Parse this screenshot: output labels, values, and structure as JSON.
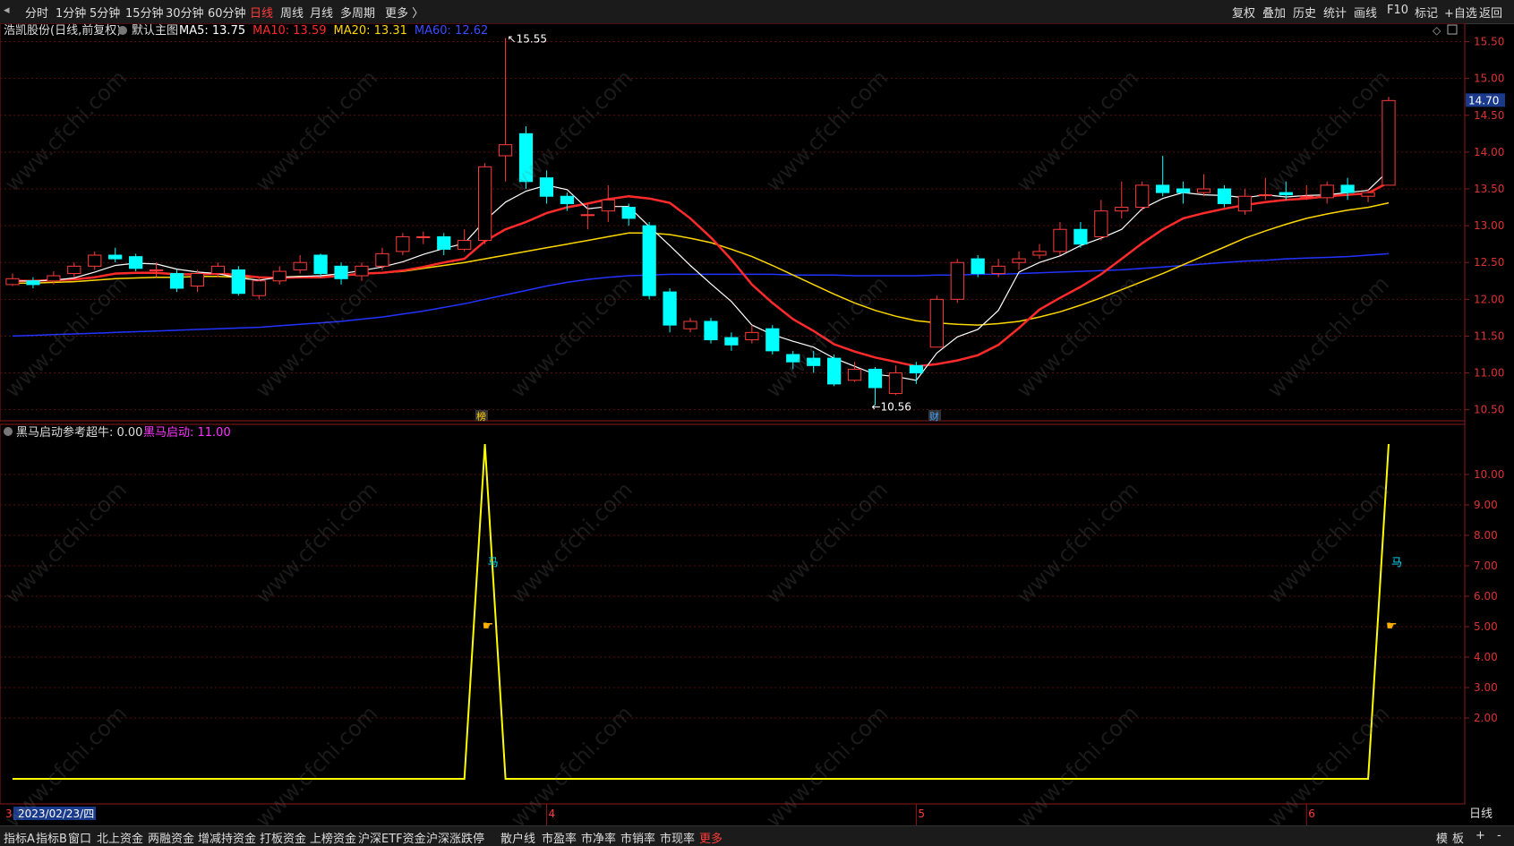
{
  "toolbar": {
    "periods": [
      "分时",
      "1分钟",
      "5分钟",
      "15分钟",
      "30分钟",
      "60分钟",
      "日线",
      "周线",
      "月线",
      "多周期",
      "更多 〉"
    ],
    "active_period": "日线",
    "right_buttons": [
      "复权",
      "叠加",
      "历史",
      "统计",
      "画线",
      "F10",
      "标记",
      "+自选",
      "返回"
    ]
  },
  "main_chart": {
    "stock_title": "浩凯股份(日线,前复权)",
    "template_label": "默认主图",
    "ma_legend": [
      {
        "label": "MA5: 13.75",
        "color": "#ffffff"
      },
      {
        "label": "MA10: 13.59",
        "color": "#ff2a2a"
      },
      {
        "label": "MA20: 13.31",
        "color": "#ffd700"
      },
      {
        "label": "MA60: 12.62",
        "color": "#3a4cff"
      }
    ],
    "high_label": "15.55",
    "low_label": "10.56",
    "current_price_tag": "14.70",
    "marker_rank": "榜",
    "marker_finance": "财",
    "price_axis": [
      "15.50",
      "15.00",
      "14.50",
      "14.00",
      "13.50",
      "13.00",
      "12.50",
      "12.00",
      "11.50",
      "11.00",
      "10.50"
    ],
    "colors": {
      "up": "#ff3b3b",
      "down": "#00ffff",
      "ma5": "#ffffff",
      "ma10": "#ff2a2a",
      "ma20": "#ffd700",
      "ma60": "#2233ff"
    }
  },
  "indicator": {
    "title": "黑马启动参考",
    "super_label": "超牛: 0.00",
    "dark_horse_label": "黑马启动: 11.00",
    "axis": [
      "10.00",
      "9.00",
      "8.00",
      "7.00",
      "6.00",
      "5.00",
      "4.00",
      "3.00",
      "2.00"
    ],
    "signal_char": "马",
    "line_color": "#ffff00"
  },
  "date_axis": {
    "cursor_date": "2023/02/23/四",
    "month_marks": [
      "4",
      "5",
      "6"
    ],
    "first_mark": "3",
    "period_label": "日线"
  },
  "bottom_tabs": [
    "指标A",
    "指标B",
    "窗口",
    "北上资金",
    "两融资金",
    "增减持资金",
    "打板资金",
    "上榜资金",
    "沪深ETF资金",
    "沪深涨跌停",
    "散户线",
    "市盈率",
    "市净率",
    "市销率",
    "市现率",
    "更多"
  ],
  "bottom_right": [
    "模",
    "板",
    "+",
    "-"
  ],
  "watermark": "www.cfchi.com",
  "chart_data": {
    "type": "candlestick",
    "candles": [
      [
        12.2,
        12.28,
        12.35,
        12.18
      ],
      [
        12.25,
        12.2,
        12.3,
        12.15
      ],
      [
        12.25,
        12.32,
        12.38,
        12.2
      ],
      [
        12.35,
        12.45,
        12.5,
        12.3
      ],
      [
        12.45,
        12.6,
        12.65,
        12.4
      ],
      [
        12.6,
        12.55,
        12.7,
        12.5
      ],
      [
        12.58,
        12.42,
        12.62,
        12.38
      ],
      [
        12.4,
        12.4,
        12.5,
        12.3
      ],
      [
        12.35,
        12.15,
        12.4,
        12.1
      ],
      [
        12.18,
        12.35,
        12.4,
        12.1
      ],
      [
        12.35,
        12.45,
        12.5,
        12.3
      ],
      [
        12.4,
        12.08,
        12.45,
        12.05
      ],
      [
        12.05,
        12.25,
        12.3,
        12.0
      ],
      [
        12.25,
        12.38,
        12.45,
        12.2
      ],
      [
        12.4,
        12.5,
        12.6,
        12.35
      ],
      [
        12.6,
        12.35,
        12.62,
        12.3
      ],
      [
        12.45,
        12.28,
        12.5,
        12.2
      ],
      [
        12.32,
        12.45,
        12.5,
        12.25
      ],
      [
        12.45,
        12.62,
        12.7,
        12.4
      ],
      [
        12.65,
        12.85,
        12.9,
        12.6
      ],
      [
        12.85,
        12.85,
        12.92,
        12.75
      ],
      [
        12.85,
        12.68,
        12.9,
        12.6
      ],
      [
        12.68,
        12.8,
        12.95,
        12.65
      ],
      [
        12.8,
        13.8,
        13.85,
        12.75
      ],
      [
        13.95,
        14.1,
        15.55,
        13.6
      ],
      [
        14.25,
        13.6,
        14.35,
        13.5
      ],
      [
        13.65,
        13.4,
        13.75,
        13.3
      ],
      [
        13.4,
        13.3,
        13.45,
        13.2
      ],
      [
        13.15,
        13.15,
        13.3,
        12.95
      ],
      [
        13.2,
        13.35,
        13.55,
        13.05
      ],
      [
        13.25,
        13.1,
        13.3,
        13.0
      ],
      [
        13.0,
        12.05,
        13.05,
        12.0
      ],
      [
        12.1,
        11.65,
        12.15,
        11.55
      ],
      [
        11.6,
        11.7,
        11.75,
        11.55
      ],
      [
        11.7,
        11.45,
        11.75,
        11.4
      ],
      [
        11.48,
        11.38,
        11.55,
        11.3
      ],
      [
        11.45,
        11.55,
        11.65,
        11.4
      ],
      [
        11.6,
        11.3,
        11.65,
        11.25
      ],
      [
        11.25,
        11.15,
        11.3,
        11.05
      ],
      [
        11.2,
        11.1,
        11.3,
        11.0
      ],
      [
        11.2,
        10.85,
        11.25,
        10.82
      ],
      [
        10.9,
        11.05,
        11.15,
        10.88
      ],
      [
        11.05,
        10.8,
        11.08,
        10.56
      ],
      [
        10.72,
        11.0,
        11.1,
        10.7
      ],
      [
        11.1,
        11.0,
        11.15,
        10.85
      ],
      [
        11.35,
        12.0,
        12.05,
        11.35
      ],
      [
        12.0,
        12.5,
        12.55,
        11.95
      ],
      [
        12.55,
        12.35,
        12.6,
        12.3
      ],
      [
        12.35,
        12.45,
        12.55,
        12.3
      ],
      [
        12.5,
        12.55,
        12.65,
        12.4
      ],
      [
        12.6,
        12.65,
        12.75,
        12.55
      ],
      [
        12.65,
        12.95,
        13.05,
        12.6
      ],
      [
        12.95,
        12.75,
        13.05,
        12.7
      ],
      [
        12.85,
        13.2,
        13.35,
        12.8
      ],
      [
        13.2,
        13.25,
        13.6,
        13.1
      ],
      [
        13.25,
        13.55,
        13.6,
        13.2
      ],
      [
        13.55,
        13.45,
        13.95,
        13.4
      ],
      [
        13.5,
        13.45,
        13.6,
        13.3
      ],
      [
        13.45,
        13.5,
        13.7,
        13.4
      ],
      [
        13.5,
        13.3,
        13.55,
        13.25
      ],
      [
        13.2,
        13.4,
        13.5,
        13.15
      ],
      [
        13.42,
        13.42,
        13.65,
        13.35
      ],
      [
        13.45,
        13.42,
        13.6,
        13.35
      ],
      [
        13.4,
        13.4,
        13.55,
        13.35
      ],
      [
        13.38,
        13.55,
        13.6,
        13.3
      ],
      [
        13.55,
        13.45,
        13.65,
        13.35
      ],
      [
        13.4,
        13.45,
        13.5,
        13.32
      ],
      [
        13.55,
        14.7,
        14.75,
        13.55
      ]
    ],
    "ma5": [
      12.25,
      12.25,
      12.26,
      12.29,
      12.37,
      12.46,
      12.49,
      12.48,
      12.41,
      12.37,
      12.35,
      12.29,
      12.26,
      12.3,
      12.31,
      12.32,
      12.35,
      12.39,
      12.44,
      12.51,
      12.61,
      12.69,
      12.76,
      13.07,
      13.32,
      13.47,
      13.55,
      13.49,
      13.23,
      13.26,
      13.26,
      12.99,
      12.73,
      12.46,
      12.21,
      11.97,
      11.65,
      11.52,
      11.43,
      11.35,
      11.2,
      11.09,
      10.98,
      10.95,
      10.9,
      11.27,
      11.49,
      11.59,
      11.85,
      12.37,
      12.5,
      12.59,
      12.73,
      12.83,
      12.95,
      13.23,
      13.37,
      13.45,
      13.42,
      13.41,
      13.38,
      13.42,
      13.39,
      13.41,
      13.42,
      13.45,
      13.48,
      13.75
    ],
    "ma10": [
      12.25,
      12.25,
      12.26,
      12.27,
      12.3,
      12.35,
      12.36,
      12.36,
      12.34,
      12.34,
      12.35,
      12.33,
      12.3,
      12.29,
      12.3,
      12.3,
      12.32,
      12.35,
      12.36,
      12.39,
      12.44,
      12.5,
      12.55,
      12.79,
      12.95,
      13.05,
      13.17,
      13.25,
      13.3,
      13.36,
      13.4,
      13.37,
      13.31,
      13.1,
      12.84,
      12.54,
      12.2,
      11.95,
      11.73,
      11.57,
      11.39,
      11.29,
      11.21,
      11.15,
      11.09,
      11.12,
      11.17,
      11.24,
      11.38,
      11.61,
      11.86,
      12.02,
      12.17,
      12.34,
      12.55,
      12.76,
      12.95,
      13.1,
      13.17,
      13.23,
      13.28,
      13.32,
      13.35,
      13.37,
      13.4,
      13.42,
      13.44,
      13.59
    ],
    "ma20": [
      12.22,
      12.22,
      12.23,
      12.24,
      12.26,
      12.28,
      12.29,
      12.3,
      12.3,
      12.31,
      12.31,
      12.3,
      12.3,
      12.3,
      12.31,
      12.31,
      12.32,
      12.34,
      12.36,
      12.38,
      12.42,
      12.46,
      12.5,
      12.55,
      12.6,
      12.65,
      12.7,
      12.75,
      12.8,
      12.85,
      12.9,
      12.9,
      12.88,
      12.83,
      12.77,
      12.68,
      12.58,
      12.46,
      12.33,
      12.2,
      12.07,
      11.95,
      11.85,
      11.77,
      11.71,
      11.68,
      11.66,
      11.65,
      11.67,
      11.7,
      11.76,
      11.83,
      11.92,
      12.02,
      12.13,
      12.24,
      12.35,
      12.47,
      12.59,
      12.71,
      12.83,
      12.93,
      13.02,
      13.1,
      13.16,
      13.21,
      13.25,
      13.31
    ],
    "ma60": [
      11.5,
      11.51,
      11.52,
      11.53,
      11.54,
      11.55,
      11.56,
      11.57,
      11.58,
      11.59,
      11.6,
      11.61,
      11.62,
      11.64,
      11.66,
      11.68,
      11.7,
      11.73,
      11.76,
      11.8,
      11.84,
      11.89,
      11.94,
      12.0,
      12.06,
      12.12,
      12.18,
      12.23,
      12.27,
      12.3,
      12.32,
      12.33,
      12.34,
      12.34,
      12.34,
      12.34,
      12.34,
      12.34,
      12.33,
      12.33,
      12.33,
      12.32,
      12.32,
      12.32,
      12.32,
      12.33,
      12.33,
      12.34,
      12.34,
      12.35,
      12.36,
      12.37,
      12.38,
      12.39,
      12.4,
      12.42,
      12.44,
      12.46,
      12.48,
      12.5,
      12.52,
      12.53,
      12.55,
      12.56,
      12.57,
      12.58,
      12.6,
      12.62
    ],
    "indicator_values": [
      0,
      0,
      0,
      0,
      0,
      0,
      0,
      0,
      0,
      0,
      0,
      0,
      0,
      0,
      0,
      0,
      0,
      0,
      0,
      0,
      0,
      0,
      0,
      11,
      0,
      0,
      0,
      0,
      0,
      0,
      0,
      0,
      0,
      0,
      0,
      0,
      0,
      0,
      0,
      0,
      0,
      0,
      0,
      0,
      0,
      0,
      0,
      0,
      0,
      0,
      0,
      0,
      0,
      0,
      0,
      0,
      0,
      0,
      0,
      0,
      0,
      0,
      0,
      0,
      0,
      0,
      0,
      11
    ],
    "price_range": [
      10.35,
      15.75
    ],
    "indicator_range": [
      0,
      11
    ]
  }
}
